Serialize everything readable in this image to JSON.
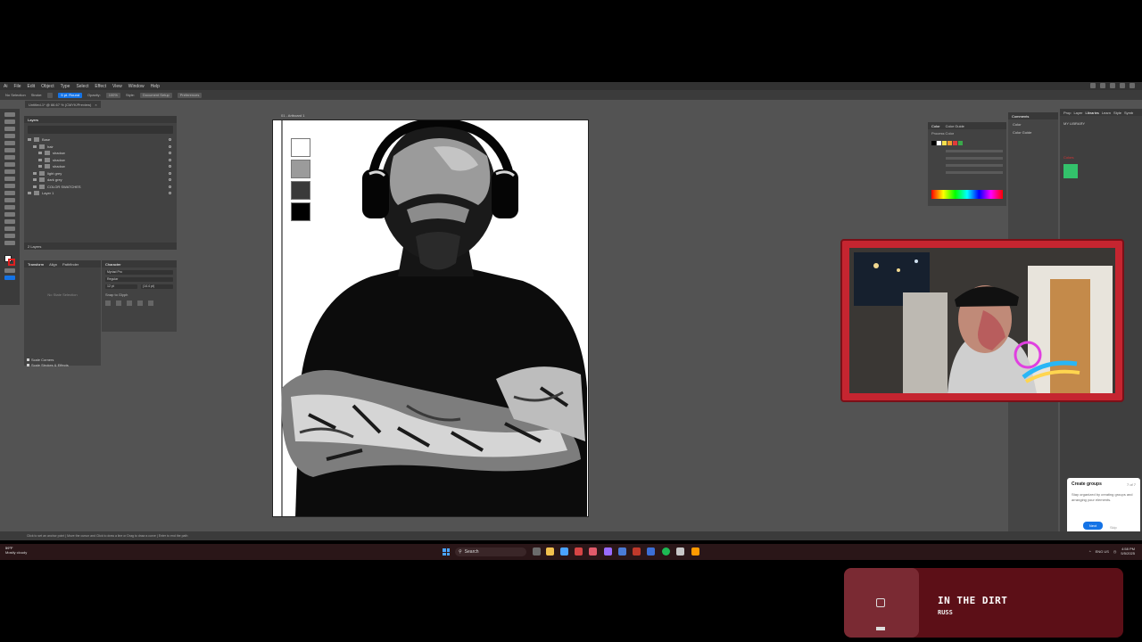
{
  "illustrator": {
    "menu": [
      "Ai",
      "File",
      "Edit",
      "Object",
      "Type",
      "Select",
      "Effect",
      "View",
      "Window",
      "Help"
    ],
    "control_bar": {
      "selection": "No Selection",
      "stroke_label": "Stroke:",
      "style_label": "5 pt. Round",
      "opacity_label": "Opacity:",
      "opacity_value": "100%",
      "style_word": "Style:",
      "document_setup": "Document Setup",
      "preferences": "Preferences"
    },
    "document_tab": "Untitled-1* @ 66.67 % (CMYK/Preview)",
    "artboard_label": "01 - Artboard 1",
    "layers_panel": {
      "tabs": [
        "Layers"
      ],
      "rows": [
        "Base",
        "hair",
        "shadow",
        "shadow",
        "shadow",
        "light grey",
        "dark grey",
        "COLOR SWATCHES",
        "Layer 1"
      ],
      "footer": "2 Layers"
    },
    "transform_panel": {
      "tabs": [
        "Transform",
        "Align",
        "Pathfinder"
      ],
      "placeholder": "No State Selection",
      "checks": [
        "Scale Corners",
        "Scale Strokes & Effects"
      ]
    },
    "character_panel": {
      "tabs": [
        "Character"
      ],
      "font": "Myriad Pro",
      "style": "Regular",
      "size": "12 pt",
      "leading": "(14.4 pt)",
      "snap": "Snap to Glyph"
    },
    "color_panel": {
      "tabs": [
        "Color",
        "Color Guide"
      ],
      "mode": "Process Color"
    },
    "properties_panel": {
      "tabs": [
        "Comments"
      ],
      "items": [
        "Color",
        "Color Guide"
      ]
    },
    "libraries_panel": {
      "tabs": [
        "Prop",
        "Layer",
        "Libraries",
        "Learn",
        "Style",
        "Symb"
      ],
      "title": "MY LIBRARY",
      "section": "Colors"
    },
    "swatches_on_artboard": [
      "#ffffff",
      "#9b9b9b",
      "#3a3a3a",
      "#000000"
    ],
    "tooltip": {
      "title": "Create groups",
      "step": "7 of 7",
      "body": "Stay organized by creating groups and arranging your elements.",
      "next": "Next",
      "skip": "Skip"
    },
    "status_bar": "Click to set an anchor point | Move the cursor and Click to draw a line or Drag to draw a curve | Enter to end the path"
  },
  "taskbar": {
    "weather_temp": "59°F",
    "weather_desc": "Mostly cloudy",
    "search_label": "Search",
    "lang": "ENG US",
    "time": "4:58 PM",
    "date": "5/5/2025"
  },
  "now_playing": {
    "title": "IN THE DIRT",
    "artist": "RUSS"
  },
  "colors": {
    "accent": "#1473e6",
    "webcam_frame": "#c52530",
    "now_playing_bg": "#5c0f17",
    "taskbar_bg": "#2a1618"
  }
}
